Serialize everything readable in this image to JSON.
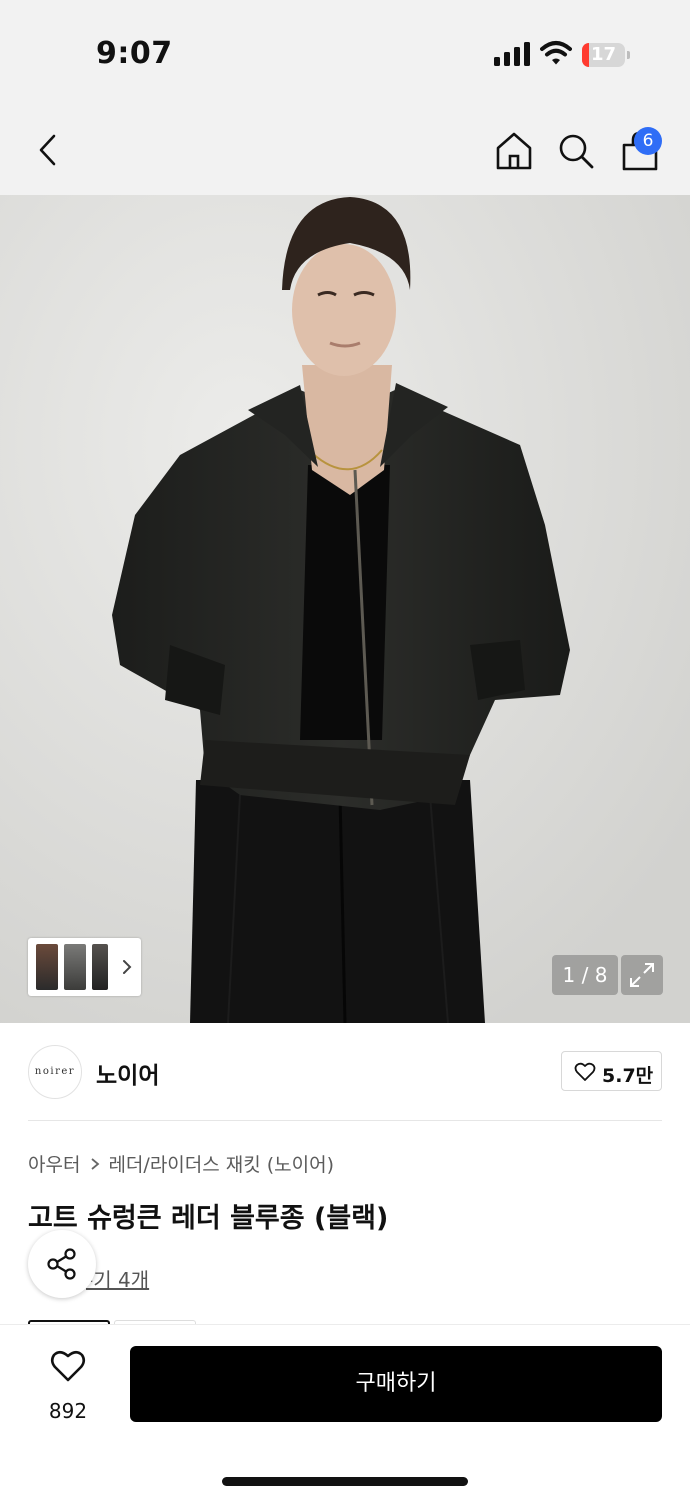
{
  "status_bar": {
    "time": "9:07",
    "battery_level": "17",
    "battery_fraction": 0.17,
    "icons": [
      "signal-icon",
      "wifi-icon",
      "battery-icon"
    ]
  },
  "nav": {
    "icons": [
      "back-icon",
      "home-icon",
      "search-icon",
      "shopping-bag-icon"
    ],
    "cart_badge": "6",
    "badge_color": "#2f6df6"
  },
  "gallery": {
    "page_indicator": "1 / 8",
    "icons": [
      "thumbnail-strip",
      "chevron-right-icon",
      "expand-icon"
    ]
  },
  "brand": {
    "logo_text": "noirer",
    "name": "노이어",
    "like_count": "5.7만"
  },
  "product": {
    "breadcrumb": [
      "아우터",
      "레더/라이더스 재킷 (노이어)"
    ],
    "title": "고트 슈렁큰 레더 블루종 (블랙)",
    "review_link": "-기 4개"
  },
  "bottom_bar": {
    "wish_count": "892",
    "buy_label": "구매하기",
    "buy_color": "#000000"
  }
}
